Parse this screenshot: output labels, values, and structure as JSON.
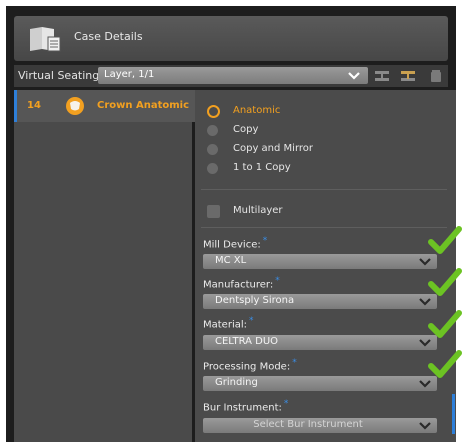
{
  "header": {
    "title": "Case Details"
  },
  "seating": {
    "label": "Virtual Seating",
    "layer_value": "Layer, 1/1"
  },
  "restoration": {
    "number": "14",
    "name": "Crown Anatomic"
  },
  "design_options": [
    {
      "label": "Anatomic",
      "selected": true
    },
    {
      "label": "Copy",
      "selected": false
    },
    {
      "label": "Copy and Mirror",
      "selected": false
    },
    {
      "label": "1 to 1 Copy",
      "selected": false
    }
  ],
  "multilayer": {
    "label": "Multilayer",
    "checked": false
  },
  "fields": {
    "mill_device": {
      "label": "Mill Device:",
      "value": "MC XL"
    },
    "manufacturer": {
      "label": "Manufacturer:",
      "value": "Dentsply Sirona"
    },
    "material": {
      "label": "Material:",
      "value": "CELTRA DUO"
    },
    "processing_mode": {
      "label": "Processing Mode:",
      "value": "Grinding"
    },
    "bur_instrument": {
      "label": "Bur Instrument:",
      "placeholder": "Select Bur Instrument"
    }
  },
  "colors": {
    "accent_orange": "#f2a020",
    "accent_blue": "#2e7fd9",
    "check_green": "#6cc323"
  }
}
